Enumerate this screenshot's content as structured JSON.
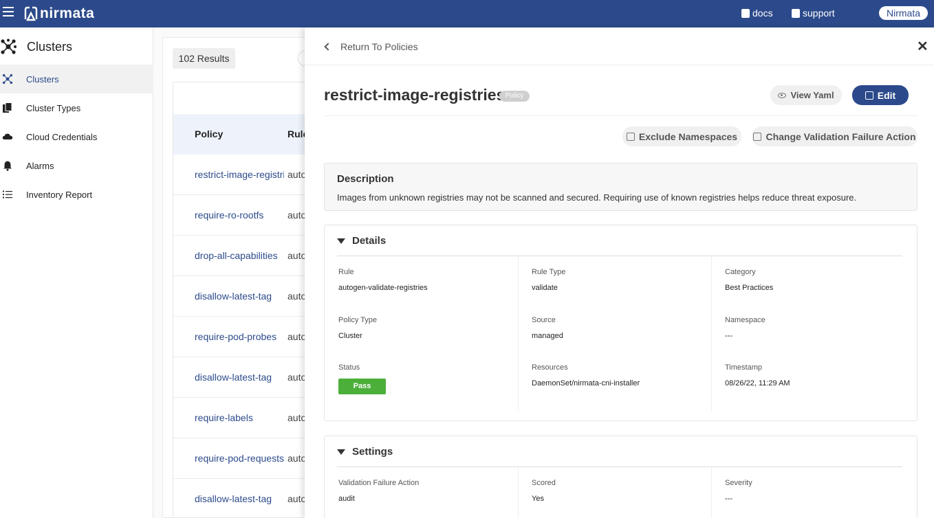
{
  "header": {
    "brand": "nirmata",
    "docs_label": "docs",
    "support_label": "support",
    "user_label": "Nirmata"
  },
  "sidebar": {
    "title": "Clusters",
    "items": [
      {
        "label": "Clusters",
        "icon": "cluster-icon"
      },
      {
        "label": "Cluster Types",
        "icon": "documents-icon"
      },
      {
        "label": "Cloud Credentials",
        "icon": "cloud-icon"
      },
      {
        "label": "Alarms",
        "icon": "bell-icon"
      },
      {
        "label": "Inventory Report",
        "icon": "list-icon"
      }
    ]
  },
  "list": {
    "results": "102 Results",
    "columns": [
      "Policy",
      "Rule"
    ],
    "rows": [
      {
        "policy": "restrict-image-registries",
        "rule": "auto"
      },
      {
        "policy": "require-ro-rootfs",
        "rule": "auto"
      },
      {
        "policy": "drop-all-capabilities",
        "rule": "auto"
      },
      {
        "policy": "disallow-latest-tag",
        "rule": "auto"
      },
      {
        "policy": "require-pod-probes",
        "rule": "auto"
      },
      {
        "policy": "disallow-latest-tag",
        "rule": "auto"
      },
      {
        "policy": "require-labels",
        "rule": "auto"
      },
      {
        "policy": "require-pod-requests-limits",
        "rule": "auto"
      },
      {
        "policy": "disallow-latest-tag",
        "rule": "auto"
      }
    ]
  },
  "drawer": {
    "return_label": "Return To Policies",
    "policy_name": "restrict-image-registries",
    "badge": "Policy",
    "view_yaml_label": "View Yaml",
    "edit_label": "Edit",
    "exclude_label": "Exclude Namespaces",
    "change_label": "Change Validation Failure Action",
    "description": {
      "title": "Description",
      "text": "Images from unknown registries may not be scanned and secured. Requiring use of known registries helps reduce threat exposure."
    },
    "details": {
      "title": "Details",
      "rule_label": "Rule",
      "rule_value": "autogen-validate-registries",
      "rule_type_label": "Rule Type",
      "rule_type_value": "validate",
      "category_label": "Category",
      "category_value": "Best Practices",
      "policy_type_label": "Policy Type",
      "policy_type_value": "Cluster",
      "source_label": "Source",
      "source_value": "managed",
      "namespace_label": "Namespace",
      "namespace_value": "---",
      "status_label": "Status",
      "status_value": "Pass",
      "resources_label": "Resources",
      "resources_value": "DaemonSet/nirmata-cni-installer",
      "timestamp_label": "Timestamp",
      "timestamp_value": "08/26/22, 11:29 AM"
    },
    "settings": {
      "title": "Settings",
      "vfa_label": "Validation Failure Action",
      "vfa_value": "audit",
      "scored_label": "Scored",
      "scored_value": "Yes",
      "severity_label": "Severity",
      "severity_value": "---"
    }
  },
  "colors": {
    "brand": "#2c4a8b",
    "pass": "#4caf3a"
  }
}
